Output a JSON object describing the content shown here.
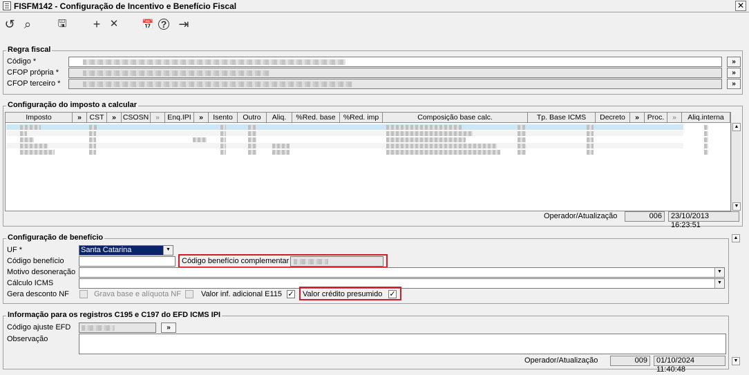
{
  "window": {
    "title": "FISFM142 - Configuração de Incentivo e Benefício Fiscal",
    "close_glyph": "✕"
  },
  "toolbar": {
    "refresh": "↺",
    "search": "⌕",
    "save": "🖫",
    "add": "+",
    "remove": "✕",
    "calendar": "📅",
    "help": "?",
    "exit": "⇥"
  },
  "regra": {
    "title": "Regra fiscal",
    "codigo_label": "Código *",
    "cfop_propria_label": "CFOP própria *",
    "cfop_terceiro_label": "CFOP terceiro *",
    "btn": "»"
  },
  "imposto": {
    "title": "Configuração do imposto a calcular",
    "columns": [
      "Imposto",
      "»",
      "CST",
      "»",
      "CSOSN",
      "»",
      "Enq.IPI",
      "»",
      "Isento",
      "Outro",
      "Aliq.",
      "%Red. base",
      "%Red. imp",
      "Composição base calc.",
      "Tp. Base ICMS",
      "Decreto",
      "»",
      "Proc.",
      "»",
      "Aliq.interna"
    ],
    "footer_label": "Operador/Atualização",
    "operador": "006",
    "atualizacao": "23/10/2013 16:23:51"
  },
  "beneficio": {
    "title": "Configuração de benefício",
    "uf_label": "UF *",
    "uf_value": "Santa Catarina",
    "codigo_beneficio_label": "Código benefício",
    "codigo_complementar_label": "Código benefício complementar",
    "motivo_label": "Motivo desoneração",
    "calculo_label": "Cálculo ICMS",
    "gera_desconto_label": "Gera desconto NF",
    "grava_base_label": "Grava base e alíquota NF",
    "valor_inf_label": "Valor inf. adicional E115",
    "valor_credito_label": "Valor crédito presumido",
    "check_mark": "✓",
    "combo_arrow": "▼"
  },
  "efd": {
    "title": "Informação para os registros C195 e C197 do EFD ICMS IPI",
    "codigo_ajuste_label": "Código ajuste EFD",
    "observacao_label": "Observação",
    "btn": "»",
    "footer_label": "Operador/Atualização",
    "operador": "009",
    "atualizacao": "01/10/2024 11:40:48"
  },
  "scroll": {
    "up": "▲",
    "down": "▼"
  }
}
